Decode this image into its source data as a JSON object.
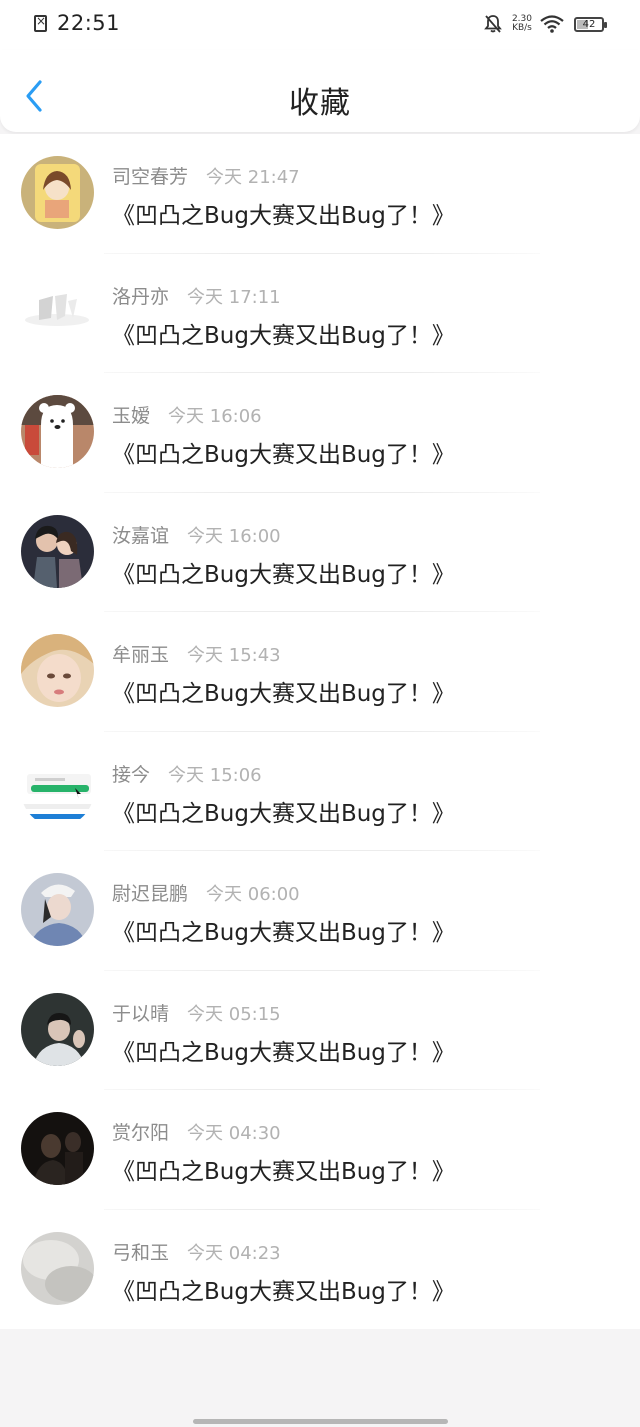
{
  "status_bar": {
    "time": "22:51",
    "net_speed": "2.30",
    "net_unit": "KB/s",
    "battery": "42"
  },
  "header": {
    "title": "收藏",
    "back_icon": "chevron-left-icon"
  },
  "colors": {
    "accent": "#2a9df4",
    "primary_text": "#222222",
    "secondary_text": "#8c8c8c",
    "time_text": "#b2b2b2"
  },
  "favorites": [
    {
      "name": "司空春芳",
      "time": "今天 21:47",
      "content": "《凹凸之Bug大赛又出Bug了！》"
    },
    {
      "name": "洛丹亦",
      "time": "今天 17:11",
      "content": "《凹凸之Bug大赛又出Bug了！》"
    },
    {
      "name": "玉嫒",
      "time": "今天 16:06",
      "content": "《凹凸之Bug大赛又出Bug了！》"
    },
    {
      "name": "汝嘉谊",
      "time": "今天 16:00",
      "content": "《凹凸之Bug大赛又出Bug了！》"
    },
    {
      "name": "牟丽玉",
      "time": "今天 15:43",
      "content": "《凹凸之Bug大赛又出Bug了！》"
    },
    {
      "name": "接今",
      "time": "今天 15:06",
      "content": "《凹凸之Bug大赛又出Bug了！》"
    },
    {
      "name": "尉迟昆鹏",
      "time": "今天 06:00",
      "content": "《凹凸之Bug大赛又出Bug了！》"
    },
    {
      "name": "于以晴",
      "time": "今天 05:15",
      "content": "《凹凸之Bug大赛又出Bug了！》"
    },
    {
      "name": "赏尔阳",
      "time": "今天 04:30",
      "content": "《凹凸之Bug大赛又出Bug了！》"
    },
    {
      "name": "弓和玉",
      "time": "今天 04:23",
      "content": "《凹凸之Bug大赛又出Bug了！》"
    }
  ]
}
